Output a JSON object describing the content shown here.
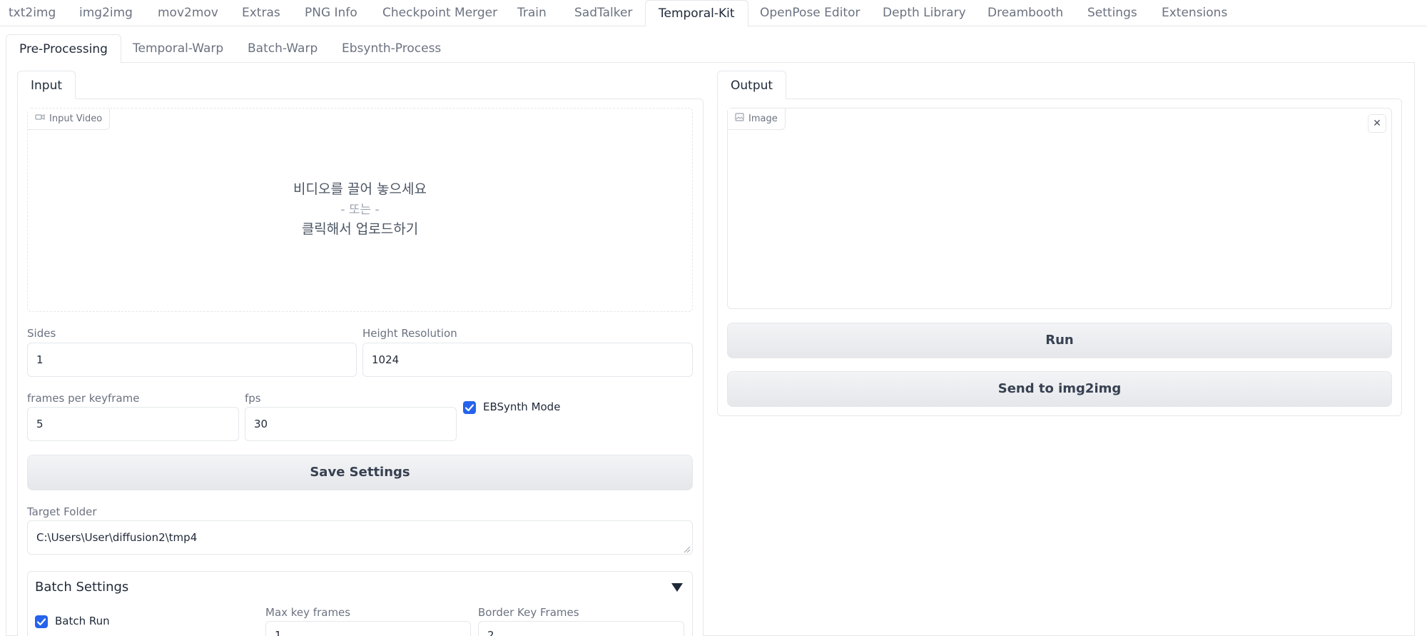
{
  "top_tabs": [
    "txt2img",
    "img2img",
    "mov2mov",
    "Extras",
    "PNG Info",
    "Checkpoint Merger",
    "Train",
    "SadTalker",
    "Temporal-Kit",
    "OpenPose Editor",
    "Depth Library",
    "Dreambooth",
    "Settings",
    "Extensions"
  ],
  "sub_tabs": [
    "Pre-Processing",
    "Temporal-Warp",
    "Batch-Warp",
    "Ebsynth-Process"
  ],
  "input_panel": {
    "tab_label": "Input",
    "video_label": "Input Video",
    "drop_text": "비디오를 끌어 놓으세요",
    "or_text": "- 또는 -",
    "click_text": "클릭해서 업로드하기",
    "sides_label": "Sides",
    "sides_value": "1",
    "height_label": "Height Resolution",
    "height_value": "1024",
    "fpk_label": "frames per keyframe",
    "fpk_value": "5",
    "fps_label": "fps",
    "fps_value": "30",
    "ebsynth_label": "EBSynth Mode",
    "ebsynth_checked": true,
    "save_button": "Save Settings",
    "target_label": "Target Folder",
    "target_value": "C:\\Users\\User\\diffusion2\\tmp4",
    "batch_title": "Batch Settings",
    "batch_run_label": "Batch Run",
    "batch_run_checked": true,
    "max_key_label": "Max key frames",
    "max_key_value": "1",
    "border_key_label": "Border Key Frames",
    "border_key_value": "2"
  },
  "output_panel": {
    "tab_label": "Output",
    "image_label": "Image",
    "run_button": "Run",
    "send_button": "Send to img2img"
  },
  "colors": {
    "accent": "#2563eb",
    "border": "#e5e7eb"
  }
}
